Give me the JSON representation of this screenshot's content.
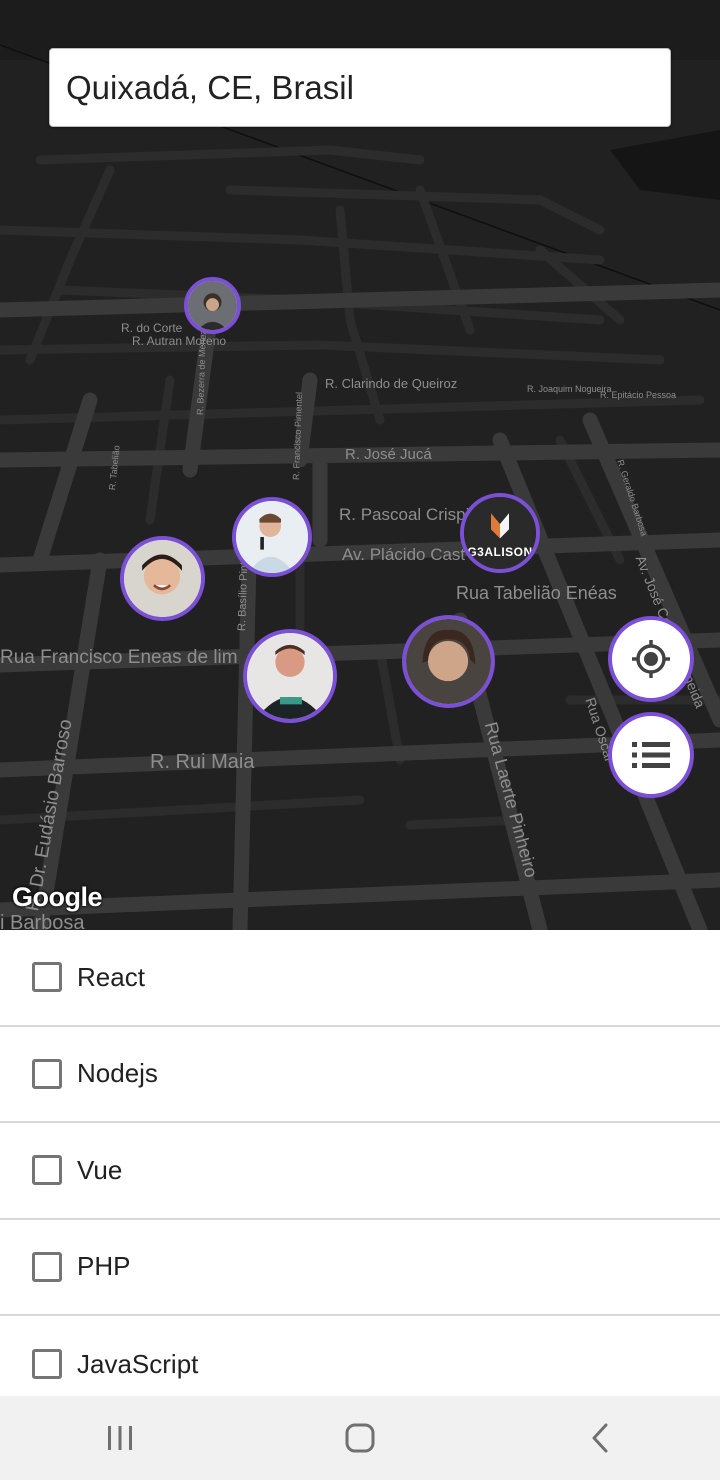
{
  "search": {
    "value": "Quixadá, CE, Brasil"
  },
  "map": {
    "attribution": "Google",
    "streets": [
      "R. do Corte",
      "R. Autran Moreno",
      "R. Clarindo de Queiroz",
      "R. José Jucá",
      "R. Pascoal Crispi",
      "Av. Plácido Cast",
      "Rua Tabelião Enéas",
      "Rua Francisco Eneas de lim",
      "R. Rui Maia",
      "R. Dr. Eudásio Barroso",
      "Rua Laerte Pinheiro",
      "Av. José Caetano Almeida",
      "Rua Oscar",
      "i Barbosa",
      "R. Basílio Pinto",
      "R. Bezerra de Menezes",
      "R. Francisco Pimentel",
      "R. Tabelião",
      "R. Geraldo Barbosa",
      "R. Joaquim Nogueira",
      "R. Epitácio Pessoa"
    ],
    "markers": [
      {
        "name": "avatar-1",
        "icon": "developer-avatar"
      },
      {
        "name": "avatar-2",
        "icon": "developer-avatar"
      },
      {
        "name": "avatar-3",
        "icon": "developer-avatar"
      },
      {
        "name": "avatar-4",
        "icon": "developer-avatar"
      },
      {
        "name": "avatar-5",
        "icon": "developer-avatar"
      },
      {
        "name": "avatar-6",
        "logo": "G3ALISON"
      }
    ]
  },
  "buttons": {
    "locate": {
      "icon": "crosshair-icon"
    },
    "list": {
      "icon": "list-icon"
    }
  },
  "techs": [
    {
      "label": "React",
      "checked": false
    },
    {
      "label": "Nodejs",
      "checked": false
    },
    {
      "label": "Vue",
      "checked": false
    },
    {
      "label": "PHP",
      "checked": false
    },
    {
      "label": "JavaScript",
      "checked": false
    }
  ],
  "nav": {
    "recents": "recents-icon",
    "home": "home-icon",
    "back": "back-icon"
  },
  "colors": {
    "accent": "#7b4fd6",
    "map_bg": "#212121",
    "road": "#3a3a3a",
    "street_label": "#8e8e8e"
  }
}
